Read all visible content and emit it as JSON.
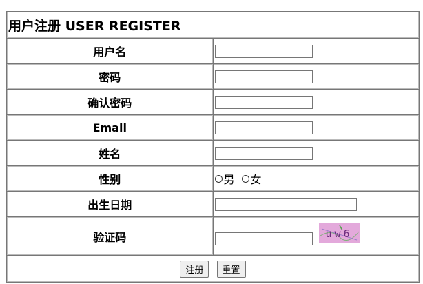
{
  "form": {
    "title": "用户注册 USER REGISTER",
    "fields": {
      "username": {
        "label": "用户名",
        "value": ""
      },
      "password": {
        "label": "密码",
        "value": ""
      },
      "confirm_password": {
        "label": "确认密码",
        "value": ""
      },
      "email": {
        "label": "Email",
        "value": ""
      },
      "name": {
        "label": "姓名",
        "value": ""
      },
      "gender": {
        "label": "性别",
        "options": [
          "男",
          "女"
        ],
        "selected": ""
      },
      "birthdate": {
        "label": "出生日期",
        "value": ""
      },
      "captcha": {
        "label": "验证码",
        "value": "",
        "image_text": "uw6"
      }
    },
    "buttons": {
      "submit_label": "注册",
      "reset_label": "重置"
    }
  }
}
